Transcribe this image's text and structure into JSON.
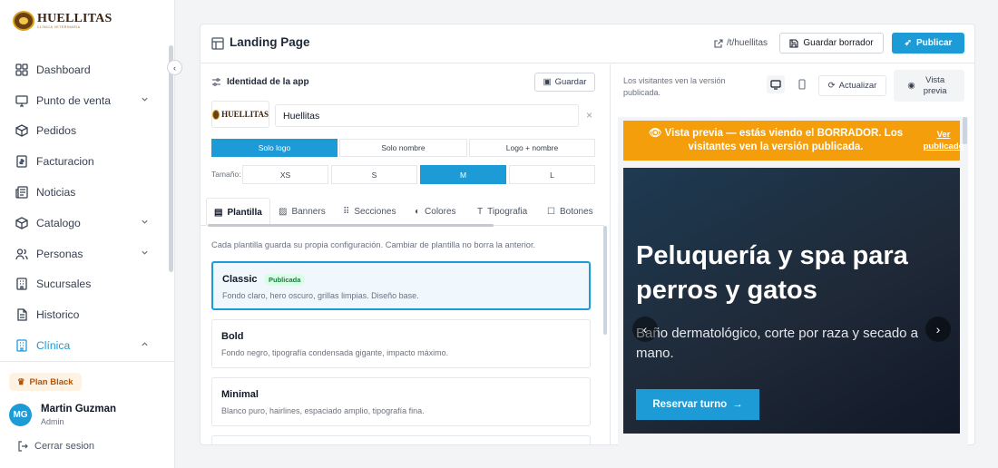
{
  "brand": {
    "name": "HUELLITAS",
    "sub": "CLÍNICA VETERINARIA"
  },
  "sidebar": {
    "items": [
      {
        "label": "Dashboard"
      },
      {
        "label": "Punto de venta"
      },
      {
        "label": "Pedidos"
      },
      {
        "label": "Facturacion"
      },
      {
        "label": "Noticias"
      },
      {
        "label": "Catalogo"
      },
      {
        "label": "Personas"
      },
      {
        "label": "Sucursales"
      },
      {
        "label": "Historico"
      },
      {
        "label": "Clínica"
      }
    ],
    "plan": "Plan Black",
    "user": {
      "initials": "MG",
      "name": "Martin Guzman",
      "role": "Admin"
    },
    "logout": "Cerrar sesion"
  },
  "header": {
    "title": "Landing Page",
    "slug": "/t/huellitas",
    "draft_label": "Guardar borrador",
    "publish_label": "Publicar"
  },
  "identity": {
    "title": "Identidad de la app",
    "save_label": "Guardar",
    "logo_text": "HUELLITAS",
    "name_value": "Huellitas",
    "display_modes": [
      "Solo logo",
      "Solo nombre",
      "Logo + nombre"
    ],
    "display_selected": "Solo logo",
    "size_label": "Tamaño:",
    "sizes": [
      "XS",
      "S",
      "M",
      "L"
    ],
    "size_selected": "M"
  },
  "tabs": [
    "Plantilla",
    "Banners",
    "Secciones",
    "Colores",
    "Tipografia",
    "Botones"
  ],
  "templates": {
    "help": "Cada plantilla guarda su propia configuración. Cambiar de plantilla no borra la anterior.",
    "items": [
      {
        "name": "Classic",
        "badge": "Publicada",
        "desc": "Fondo claro, hero oscuro, grillas limpias. Diseño base."
      },
      {
        "name": "Bold",
        "desc": "Fondo negro, tipografía condensada gigante, impacto máximo."
      },
      {
        "name": "Minimal",
        "desc": "Blanco puro, hairlines, espaciado amplio, tipografía fina."
      }
    ]
  },
  "preview": {
    "note": "Los visitantes ven la versión publicada.",
    "refresh_label": "Actualizar",
    "vista_label": "Vista previa",
    "banner_text": "👁 Vista previa — estás viendo el BORRADOR. Los visitantes ven la versión publicada.",
    "banner_link": "Ver publicado",
    "hero_title": "Peluquería y spa para perros y gatos",
    "hero_sub": "Baño dermatológico, corte por raza y secado a mano.",
    "hero_cta": "Reservar turno"
  },
  "colors": {
    "accent": "#1d9bd6",
    "warning": "#f59e0b",
    "success": "#15803d"
  }
}
